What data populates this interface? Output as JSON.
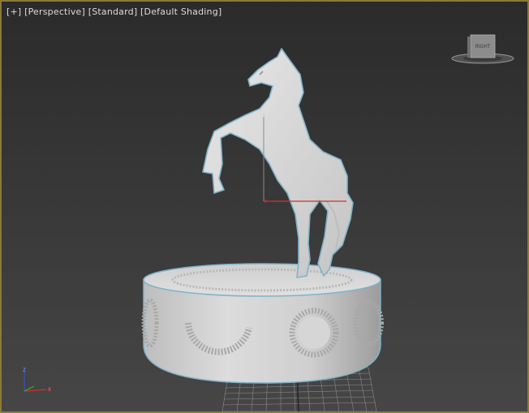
{
  "viewport": {
    "menu_label": "[+]",
    "view_label": "[Perspective]",
    "style_label": "[Standard]",
    "shading_label": "[Default Shading]"
  },
  "viewcube": {
    "face_label": "RIGHT"
  },
  "gizmo": {
    "z_label": "z",
    "x_label": "x"
  },
  "triad": {
    "z_label": "z",
    "x_label": "x"
  },
  "colors": {
    "viewport_border": "#8a7a3a",
    "selection_outline": "#7fb3c8",
    "x_axis": "#d03030",
    "y_axis": "#30b040",
    "z_axis": "#3050d0"
  }
}
